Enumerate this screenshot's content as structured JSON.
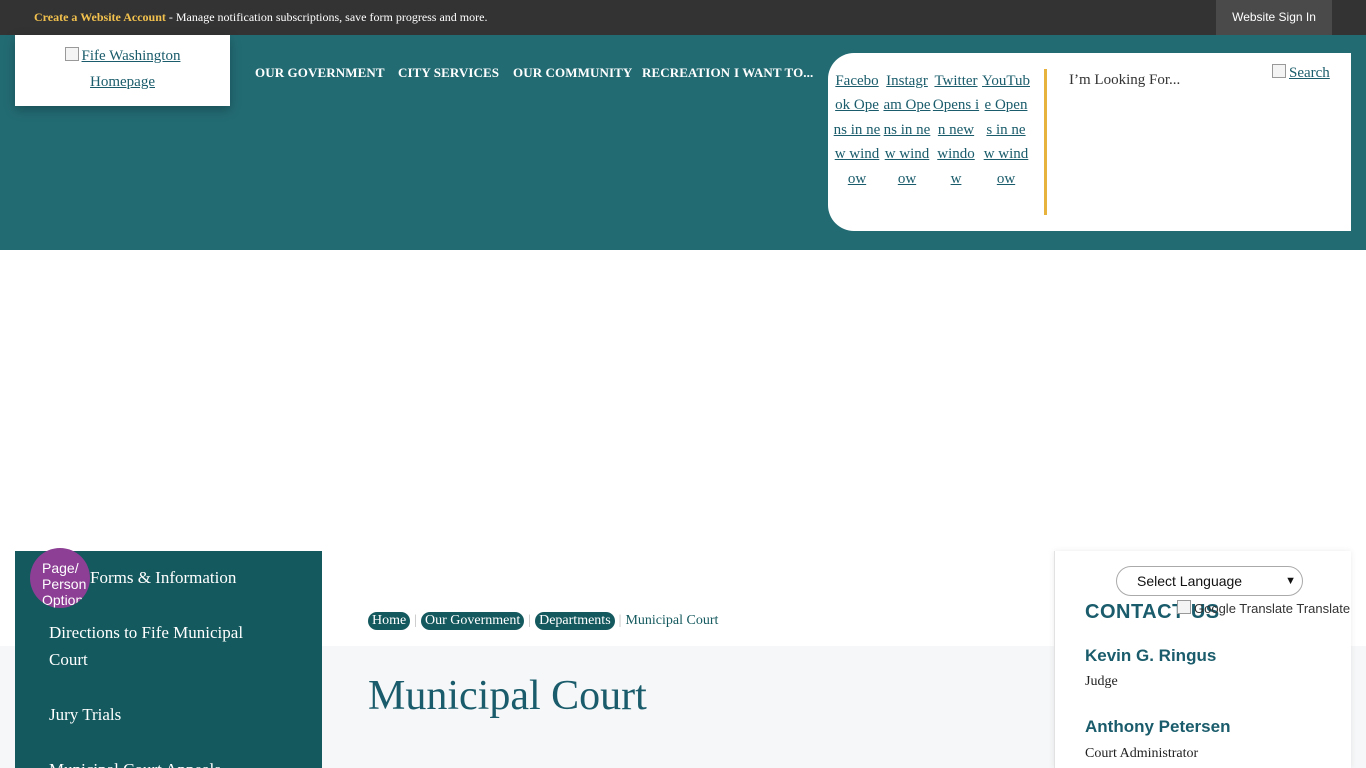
{
  "topbar": {
    "create_account": "Create a Website Account",
    "message": " - Manage notification subscriptions, save form progress and more.",
    "sign_in": "Website Sign In"
  },
  "logo": {
    "alt_line1": "Fife Washington",
    "alt_line2": "Homepage"
  },
  "nav": [
    {
      "label": "OUR GOVERNMENT"
    },
    {
      "label": "CITY SERVICES"
    },
    {
      "label": "OUR COMMUNITY"
    },
    {
      "label": "RECREATION"
    },
    {
      "label": "I WANT TO..."
    }
  ],
  "social": [
    {
      "label": "Facebook Opens in new window",
      "icon": "facebook-icon"
    },
    {
      "label": "Instagram Opens in new window",
      "icon": "instagram-icon"
    },
    {
      "label": "Twitter Opens in new window",
      "icon": "twitter-icon"
    },
    {
      "label": "YouTube Opens in new window",
      "icon": "youtube-icon"
    }
  ],
  "search": {
    "placeholder": "I’m Looking For...",
    "button": "Search"
  },
  "page_options": {
    "label": "Page/ Person Option"
  },
  "sidebar": {
    "items": [
      {
        "label": "Forms & Information"
      },
      {
        "label": "Directions to Fife Municipal Court"
      },
      {
        "label": "Jury Trials"
      },
      {
        "label": "Municipal Court Appeals"
      }
    ]
  },
  "breadcrumb": {
    "items": [
      "Home",
      "Our Government",
      "Departments"
    ],
    "current": "Municipal Court"
  },
  "main": {
    "title": "Municipal Court"
  },
  "translate": {
    "select_label": "Select Language",
    "attribution": "Google Translate Translate"
  },
  "contact": {
    "title": "CONTACT US",
    "people": [
      {
        "name": "Kevin G. Ringus",
        "role": "Judge"
      },
      {
        "name": "Anthony Petersen",
        "role": "Court Administrator"
      }
    ]
  },
  "colors": {
    "header_teal": "#236b73",
    "sidebar_teal": "#14595e",
    "accent_gold": "#e8b33c",
    "topbar_dark": "#333333",
    "page_options_purple": "#8c3f94"
  }
}
